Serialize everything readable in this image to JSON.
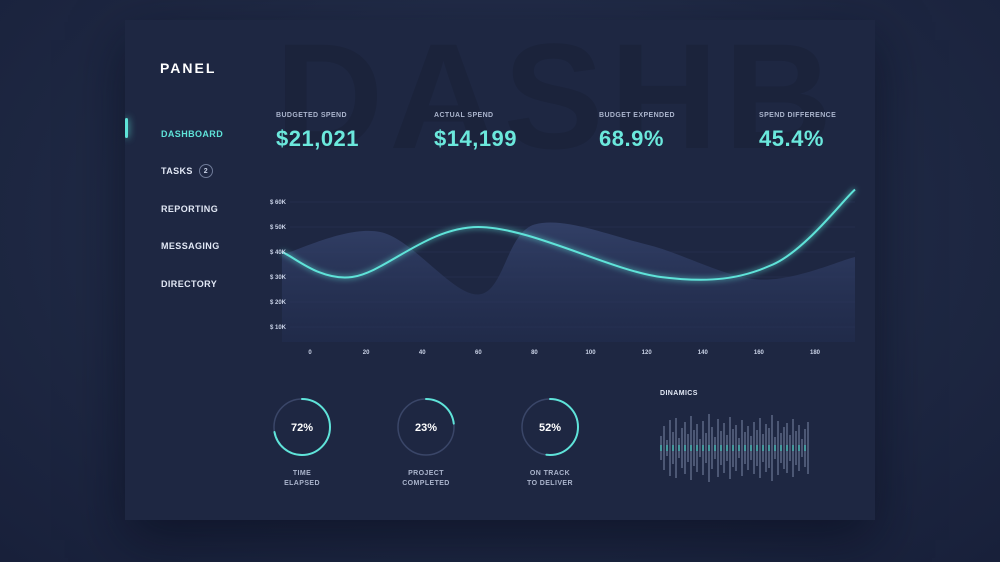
{
  "brand": "PANEL",
  "watermark": "DASHB",
  "nav": [
    {
      "label": "DASHBOARD",
      "active": true
    },
    {
      "label": "TASKS",
      "badge": "2"
    },
    {
      "label": "REPORTING"
    },
    {
      "label": "MESSAGING"
    },
    {
      "label": "DIRECTORY"
    }
  ],
  "stats": [
    {
      "label": "BUDGETED SPEND",
      "value": "$21,021"
    },
    {
      "label": "ACTUAL SPEND",
      "value": "$14,199"
    },
    {
      "label": "BUDGET EXPENDED",
      "value": "68.9%"
    },
    {
      "label": "SPEND DIFFERENCE",
      "value": "45.4%"
    }
  ],
  "colors": {
    "accent": "#5fe3d9",
    "panel": "#1e2742",
    "background": "#1f2944",
    "area": "#2d3a5e"
  },
  "chart_data": {
    "type": "line",
    "x_ticks": [
      0,
      20,
      40,
      60,
      80,
      100,
      120,
      140,
      160,
      180
    ],
    "y_ticks": [
      "$ 60K",
      "$ 50K",
      "$ 40K",
      "$ 30K",
      "$ 20K",
      "$ 10K"
    ],
    "xlim": [
      0,
      180
    ],
    "ylim": [
      10,
      60
    ],
    "series": [
      {
        "kind": "line",
        "x": [
          -10,
          15,
          60,
          125,
          165,
          195
        ],
        "y": [
          40,
          30,
          50,
          30,
          35,
          65
        ]
      },
      {
        "kind": "area",
        "x": [
          -10,
          25,
          60,
          80,
          120,
          160,
          195
        ],
        "y": [
          39,
          48,
          23,
          51,
          43,
          29,
          38
        ]
      }
    ]
  },
  "gauges": [
    {
      "percent": 72,
      "value": "72%",
      "label_line1": "TIME",
      "label_line2": "ELAPSED"
    },
    {
      "percent": 23,
      "value": "23%",
      "label_line1": "PROJECT",
      "label_line2": "COMPLETED"
    },
    {
      "percent": 52,
      "value": "52%",
      "label_line1": "ON TRACK",
      "label_line2": "TO DELIVER"
    }
  ],
  "dynamics": {
    "title": "DINAMICS",
    "bars": [
      12,
      22,
      8,
      28,
      16,
      30,
      10,
      20,
      26,
      14,
      32,
      18,
      24,
      9,
      27,
      15,
      34,
      21,
      11,
      29,
      17,
      25,
      13,
      31,
      19,
      23,
      10,
      28,
      16,
      22,
      12,
      26,
      18,
      30,
      14,
      24,
      20,
      33,
      11,
      27,
      15,
      21,
      25,
      13,
      29,
      17,
      23,
      9,
      19,
      26
    ]
  }
}
